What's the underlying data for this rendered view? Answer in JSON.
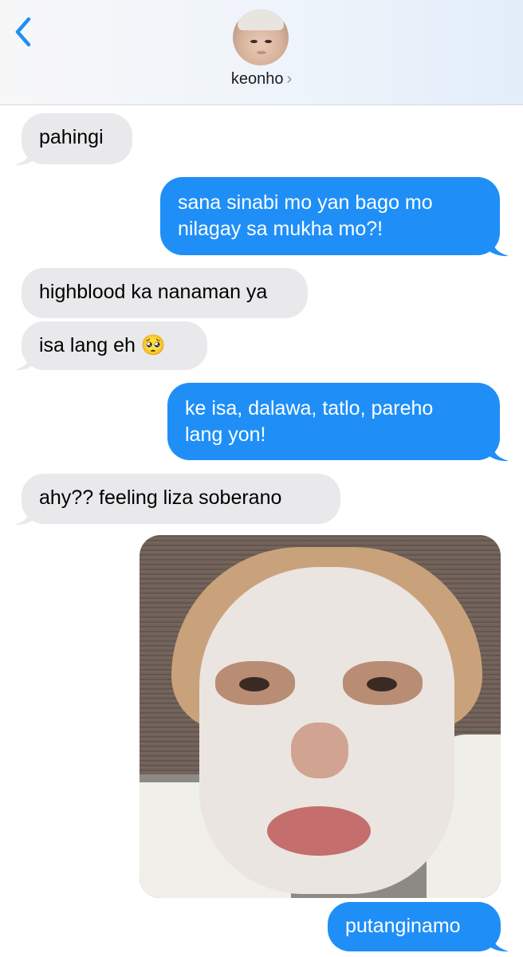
{
  "header": {
    "back_icon": "chevron-left-icon",
    "contact_name": "keonho",
    "contact_chevron": "›"
  },
  "colors": {
    "incoming_bubble": "#e9e9eb",
    "outgoing_bubble": "#1f8ff7",
    "back_accent": "#1f8ff7"
  },
  "messages": [
    {
      "direction": "incoming",
      "text": "pahingi"
    },
    {
      "direction": "outgoing",
      "lines": [
        "sana sinabi mo yan bago mo",
        "nilagay sa mukha mo?!"
      ]
    },
    {
      "direction": "incoming",
      "text": "highblood ka nanaman ya"
    },
    {
      "direction": "incoming",
      "text": "isa lang eh 🥺"
    },
    {
      "direction": "outgoing",
      "lines": [
        "ke isa, dalawa, tatlo, pareho",
        "lang yon!"
      ]
    },
    {
      "direction": "incoming",
      "text": "ahy?? feeling liza soberano"
    },
    {
      "direction": "outgoing",
      "type": "photo"
    },
    {
      "direction": "outgoing",
      "text": "putanginamo"
    }
  ]
}
